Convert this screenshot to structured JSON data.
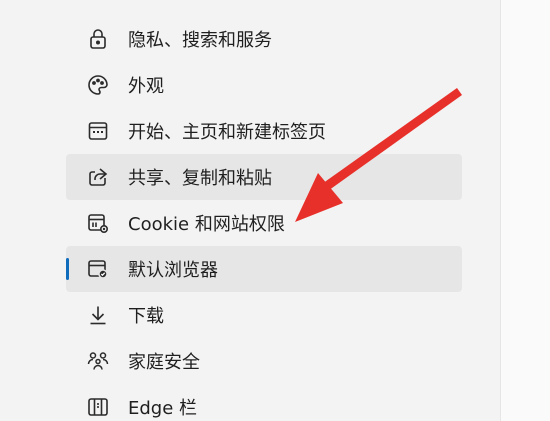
{
  "sidebar": {
    "items": [
      {
        "label": "隐私、搜索和服务",
        "icon": "lock-icon"
      },
      {
        "label": "外观",
        "icon": "palette-icon"
      },
      {
        "label": "开始、主页和新建标签页",
        "icon": "home-page-icon"
      },
      {
        "label": "共享、复制和粘贴",
        "icon": "share-icon"
      },
      {
        "label": "Cookie 和网站权限",
        "icon": "site-permissions-icon"
      },
      {
        "label": "默认浏览器",
        "icon": "default-browser-icon",
        "selected": true
      },
      {
        "label": "下载",
        "icon": "download-icon"
      },
      {
        "label": "家庭安全",
        "icon": "family-icon"
      },
      {
        "label": "Edge 栏",
        "icon": "edge-bar-icon"
      }
    ]
  },
  "colors": {
    "accent": "#0f6cbd",
    "arrow": "#e8302a",
    "panel_bg": "#f3f3f3",
    "hover_bg": "#e6e6e6"
  }
}
